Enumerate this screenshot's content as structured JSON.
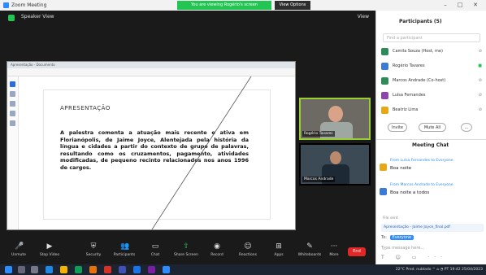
{
  "titlebar": {
    "app_title": "Zoom Meeting",
    "share_banner": "You are viewing Rogério's screen",
    "view_options": "View Options",
    "controls": [
      "–",
      "□",
      "✕"
    ]
  },
  "meeting_top": {
    "speaker_view": "Speaker View",
    "view": "View"
  },
  "shared_doc": {
    "heading": "APRESENTAÇÃO",
    "body": "A palestra comenta a atuação mais recente e ativa em Florianópolis, de Jaime Joyce, Alentejada pela história da língua e cidades a partir do contexto de grupo de palavras, resultando como os cruzamentos, pagamento, atividades modificadas, de pequeno recinto relacionados nos anos 1996 de cargos.",
    "title_text": "Apresentação - Documento"
  },
  "tiles": {
    "tile1_name": "Rogério Tavares",
    "tile2_name": "Marcos Andrade"
  },
  "toolbar": {
    "buttons": [
      {
        "icon": "mic-icon",
        "glyph": "🎤",
        "label": "Unmute"
      },
      {
        "icon": "video-icon",
        "glyph": "▶",
        "label": "Stop Video"
      },
      {
        "icon": "security-icon",
        "glyph": "⛨",
        "label": "Security"
      },
      {
        "icon": "participants-icon",
        "glyph": "👥",
        "label": "Participants"
      },
      {
        "icon": "chat-icon",
        "glyph": "▭",
        "label": "Chat"
      },
      {
        "icon": "share-icon",
        "glyph": "⇧",
        "label": "Share Screen"
      },
      {
        "icon": "record-icon",
        "glyph": "◉",
        "label": "Record"
      },
      {
        "icon": "reactions-icon",
        "glyph": "☺",
        "label": "Reactions"
      },
      {
        "icon": "apps-icon",
        "glyph": "⊞",
        "label": "Apps"
      },
      {
        "icon": "whiteboard-icon",
        "glyph": "✎",
        "label": "Whiteboards"
      },
      {
        "icon": "more-icon",
        "glyph": "···",
        "label": "More"
      }
    ],
    "end": "End"
  },
  "panel": {
    "participants_title": "Participants (5)",
    "search_placeholder": "Find a participant",
    "participants": [
      {
        "name": "Camila Souza (Host, me)",
        "color": "#2e8b57"
      },
      {
        "name": "Rogério Tavares",
        "color": "#3a7bd5"
      },
      {
        "name": "Marcos Andrade (Co-host)",
        "color": "#2e8b57"
      },
      {
        "name": "Luísa Fernandes",
        "color": "#8e44ad"
      },
      {
        "name": "Beatriz Lima",
        "color": "#e6a817"
      }
    ],
    "invite": "Invite",
    "mute_all": "Mute All",
    "more": "...",
    "chat_title": "Meeting Chat",
    "messages": [
      {
        "from": "From Luísa Fernandes  to Everyone",
        "text": "Boa noite",
        "color": "#e6a817"
      },
      {
        "from": "From Marcos Andrade  to Everyone",
        "text": "Boa noite a todos",
        "color": "#3a7bd5"
      }
    ],
    "file_sent": "File sent",
    "file_link": "Apresentação - Jaime Joyce_final.pdf",
    "to_label": "To:",
    "to_target": "Everyone",
    "chat_placeholder": "Type message here...",
    "chat_tools": "T ☺ ▭ ···"
  },
  "taskbar": {
    "tray": "22°C  Pred. nublado  ^  ⌂  ◔  PT  19:42  25/04/2023"
  }
}
